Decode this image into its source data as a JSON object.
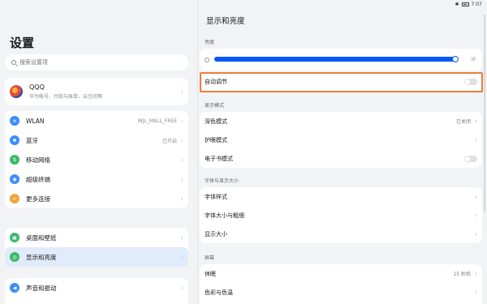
{
  "status": {
    "time_left": "",
    "time_right": "7:07"
  },
  "left": {
    "title": "设置",
    "search_placeholder": "搜索设置项",
    "account": {
      "name": "QQQ",
      "subtitle": "华为帐号、付款与账单、云空间等"
    },
    "group1": [
      {
        "label": "WLAN",
        "value": "WJL_MALL_FREE",
        "icon": "wifi-icon",
        "color": "#3a8dff"
      },
      {
        "label": "蓝牙",
        "value": "已开启",
        "icon": "bluetooth-icon",
        "color": "#3a8dff"
      },
      {
        "label": "移动网络",
        "value": "",
        "icon": "mobile-network-icon",
        "color": "#3cb96a"
      },
      {
        "label": "超级终端",
        "value": "",
        "icon": "super-device-icon",
        "color": "#3a8dff"
      },
      {
        "label": "更多连接",
        "value": "",
        "icon": "more-connections-icon",
        "color": "#f2a43a"
      }
    ],
    "group2": [
      {
        "label": "桌面和壁纸",
        "icon": "wallpaper-icon",
        "color": "#3cb96a"
      },
      {
        "label": "显示和亮度",
        "icon": "display-icon",
        "color": "#3cb96a"
      }
    ],
    "group3": [
      {
        "label": "声音和振动",
        "icon": "sound-icon",
        "color": "#3a8dff"
      }
    ]
  },
  "right": {
    "title": "显示和亮度",
    "brightness_label": "亮度",
    "brightness_level": 0.97,
    "auto_adjust": "自动调节",
    "display_mode_label": "显示模式",
    "dark_mode": "深色模式",
    "dark_mode_value": "已关闭",
    "eye_comfort": "护眼模式",
    "ebook_mode": "电子书模式",
    "font_label": "字体与显示大小",
    "font_style": "字体样式",
    "font_size": "字体大小与粗细",
    "display_size": "显示大小",
    "screen_label": "屏幕",
    "sleep": "休眠",
    "sleep_value": "15 秒后",
    "color_temp": "色彩与色温"
  }
}
